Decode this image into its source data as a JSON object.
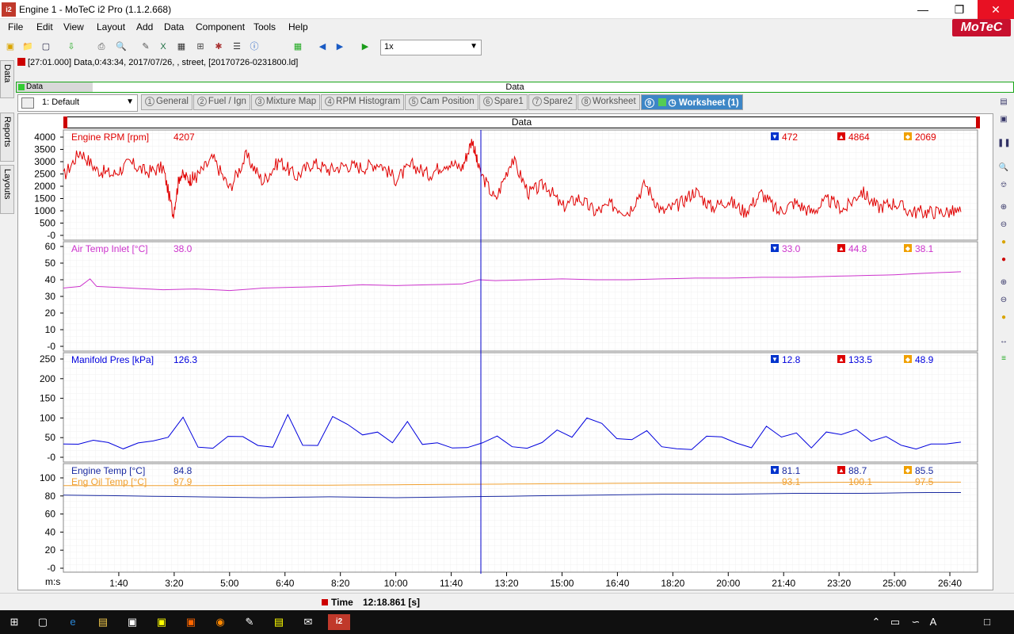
{
  "window": {
    "title": "Engine 1 - MoTeC i2 Pro (1.1.2.668)",
    "app_logo": "i2",
    "brand": "MoTeC"
  },
  "menu": [
    "File",
    "Edit",
    "View",
    "Layout",
    "Add",
    "Data",
    "Component",
    "Tools",
    "Help"
  ],
  "toolbar": {
    "zoom_value": "1x"
  },
  "info_line": "[27:01.000] Data,0:43:34, 2017/07/26, , street, [20170726-0231800.ld]",
  "side_tabs": {
    "data": "Data",
    "reports": "Reports",
    "layouts": "Layouts"
  },
  "data_bar": {
    "left_label": "Data",
    "center_label": "Data"
  },
  "layout_select": "1: Default",
  "tabs": [
    {
      "num": "1",
      "label": "General"
    },
    {
      "num": "2",
      "label": "Fuel / Ign"
    },
    {
      "num": "3",
      "label": "Mixture Map"
    },
    {
      "num": "4",
      "label": "RPM Histogram"
    },
    {
      "num": "5",
      "label": "Cam Position"
    },
    {
      "num": "6",
      "label": "Spare1"
    },
    {
      "num": "7",
      "label": "Spare2"
    },
    {
      "num": "8",
      "label": "Worksheet"
    },
    {
      "num": "9",
      "label": "Worksheet (1)",
      "active": true
    }
  ],
  "graph_title": "Data",
  "colors": {
    "rpm": "#e00000",
    "air": "#cc33cc",
    "manifold": "#0000dd",
    "eng_temp": "#1a2aa0",
    "oil": "#f0a030",
    "min_marker": "#0033cc",
    "max_marker": "#dd0000",
    "avg_marker": "#f0a000"
  },
  "chart_data": [
    {
      "type": "line",
      "name": "Engine RPM [rpm]",
      "cursor_value": "4207",
      "stats": {
        "min": "472",
        "max": "4864",
        "avg": "2069"
      },
      "y_ticks": [
        "4000",
        "3500",
        "3000",
        "2500",
        "2000",
        "1500",
        "1000",
        "500",
        "-0"
      ],
      "ylim": [
        0,
        4200
      ],
      "series": [
        {
          "name": "Engine RPM [rpm]",
          "x_min": [
            0,
            0.5,
            1,
            1.5,
            2,
            2.5,
            3,
            3.3,
            3.5,
            3.8,
            4,
            4.5,
            5,
            5.5,
            6,
            6.5,
            7,
            7.5,
            8,
            8.5,
            9,
            9.5,
            10,
            10.5,
            11,
            11.5,
            12,
            12.3,
            12.5,
            13,
            13.5,
            14,
            14.5,
            15,
            15.5,
            16,
            16.5,
            17,
            17.5,
            18,
            18.5,
            19,
            19.5,
            20,
            20.5,
            21,
            21.5,
            22,
            22.5,
            23,
            23.5,
            24,
            24.5,
            25,
            25.5,
            26,
            26.5,
            27
          ],
          "values": [
            2500,
            3600,
            2800,
            2600,
            3100,
            2700,
            2900,
            900,
            2600,
            2400,
            2500,
            3300,
            2000,
            3400,
            2300,
            3200,
            2500,
            3100,
            2800,
            3000,
            2900,
            3100,
            2400,
            3000,
            2600,
            3100,
            2900,
            4100,
            2800,
            1500,
            3300,
            1800,
            2200,
            1200,
            1600,
            1000,
            1300,
            1000,
            2200,
            1000,
            1300,
            1900,
            1200,
            1500,
            1000,
            1800,
            1000,
            1400,
            1000,
            1500,
            1100,
            1900,
            1200,
            1400,
            1000,
            1000,
            1000,
            1000
          ]
        }
      ]
    },
    {
      "type": "line",
      "name": "Air Temp Inlet [°C]",
      "cursor_value": "38.0",
      "stats": {
        "min": "33.0",
        "max": "44.8",
        "avg": "38.1"
      },
      "y_ticks": [
        "60",
        "50",
        "40",
        "30",
        "20",
        "10",
        "-0"
      ],
      "ylim": [
        0,
        60
      ],
      "series": [
        {
          "name": "Air Temp Inlet [°C]",
          "x_min": [
            0,
            0.5,
            0.8,
            1,
            2,
            3,
            4,
            5,
            6,
            7,
            8,
            9,
            10,
            11,
            12,
            12.5,
            13,
            14,
            15,
            16,
            17,
            18,
            19,
            20,
            21,
            22,
            23,
            24,
            25,
            26,
            27
          ],
          "values": [
            35,
            36,
            40.5,
            36,
            35,
            34,
            34.5,
            33.5,
            35,
            35.5,
            36,
            37,
            36.5,
            37,
            37.5,
            40,
            39.5,
            40,
            40.5,
            40,
            40,
            40.5,
            41,
            41,
            41.5,
            41.5,
            42,
            42.5,
            43,
            44,
            44.8
          ]
        }
      ]
    },
    {
      "type": "line",
      "name": "Manifold Pres [kPa]",
      "cursor_value": "126.3",
      "stats": {
        "min": "12.8",
        "max": "133.5",
        "avg": "48.9"
      },
      "y_ticks": [
        "250",
        "200",
        "150",
        "100",
        "50",
        "-0"
      ],
      "ylim": [
        0,
        260
      ],
      "series": [
        {
          "name": "Manifold Pres [kPa]",
          "x_min": [
            0,
            27
          ],
          "values": [
            40,
            40
          ]
        }
      ]
    },
    {
      "type": "line",
      "name": "Engine Temp / Eng Oil Temp",
      "traces": [
        {
          "name": "Engine Temp [°C]",
          "cursor_value": "84.8",
          "stats": {
            "min": "81.1",
            "max": "88.7",
            "avg": "85.5"
          }
        },
        {
          "name": "Eng Oil Temp [°C]",
          "cursor_value": "97.9",
          "stats": {
            "min": "93.1",
            "max": "100.1",
            "avg": "97.5"
          }
        }
      ],
      "y_ticks": [
        "100",
        "80",
        "60",
        "40",
        "20",
        "-0"
      ],
      "ylim": [
        0,
        105
      ],
      "series": [
        {
          "name": "Engine Temp [°C]",
          "x_min": [
            0,
            2,
            4,
            6,
            8,
            10,
            12,
            14,
            16,
            18,
            20,
            22,
            24,
            26,
            27
          ],
          "values": [
            85,
            84,
            83,
            82,
            83,
            82,
            83,
            84,
            85,
            86,
            86,
            87,
            87,
            88,
            88
          ]
        },
        {
          "name": "Eng Oil Temp [°C]",
          "x_min": [
            0,
            2,
            4,
            6,
            8,
            10,
            12,
            14,
            16,
            18,
            20,
            22,
            24,
            26,
            27
          ],
          "values": [
            96,
            96,
            96,
            96.5,
            96.5,
            97,
            97.5,
            98,
            98.5,
            99,
            99,
            99.5,
            100,
            100,
            100
          ]
        }
      ]
    }
  ],
  "x_axis": {
    "unit_label": "m:s",
    "ticks": [
      "1:40",
      "3:20",
      "5:00",
      "6:40",
      "8:20",
      "10:00",
      "11:40",
      "13:20",
      "15:00",
      "16:40",
      "18:20",
      "20:00",
      "21:40",
      "23:20",
      "25:00",
      "26:40"
    ]
  },
  "status": {
    "label": "Time",
    "value": "12:18.861 [s]"
  }
}
